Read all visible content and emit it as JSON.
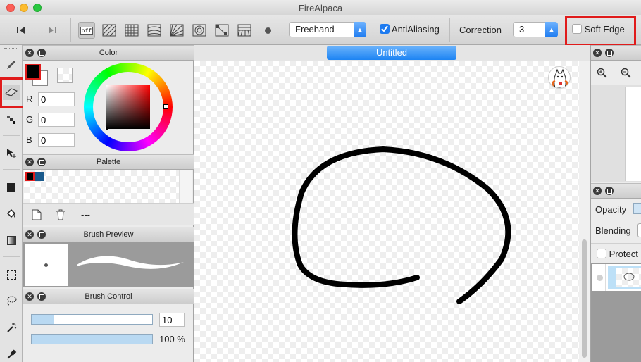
{
  "window": {
    "title": "FireAlpaca"
  },
  "toolbar": {
    "snap_off_label": "off",
    "stroke_mode": "Freehand",
    "antialiasing_label": "AntiAliasing",
    "antialiasing_checked": true,
    "correction_label": "Correction",
    "correction_value": "3",
    "soft_edge_label": "Soft Edge",
    "soft_edge_checked": false
  },
  "color_panel": {
    "title": "Color",
    "r_label": "R",
    "r_value": "0",
    "g_label": "G",
    "g_value": "0",
    "b_label": "B",
    "b_value": "0",
    "primary_color": "#000000",
    "secondary_color": "#ffffff"
  },
  "palette_panel": {
    "title": "Palette",
    "swatches": [
      "#000000",
      "#1a5a8c"
    ],
    "name": "---"
  },
  "brush_preview_panel": {
    "title": "Brush Preview"
  },
  "brush_control_panel": {
    "title": "Brush Control",
    "size_value": "10",
    "size_fraction": 0.18,
    "opacity_label": "100 %",
    "opacity_fraction": 1.0
  },
  "document": {
    "tab_title": "Untitled"
  },
  "layer_panel": {
    "opacity_label": "Opacity",
    "blending_label": "Blending",
    "protect_label": "Protect"
  },
  "colors": {
    "accent": "#1e7bf0",
    "highlight_red": "#e01b1b",
    "slider_fill": "#b9d9f2"
  }
}
